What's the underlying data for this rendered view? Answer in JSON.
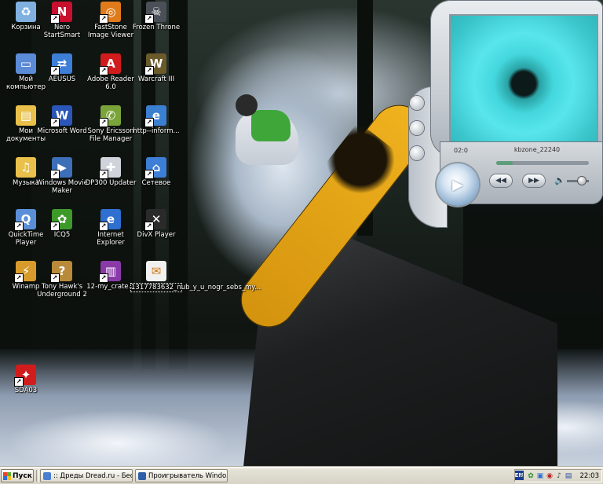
{
  "desktop": {
    "icons": [
      {
        "label": "Корзина",
        "icon": "recycle-bin-icon"
      },
      {
        "label": "Nero StartSmart",
        "icon": "nero-icon"
      },
      {
        "label": "FastStone Image Viewer",
        "icon": "faststone-icon"
      },
      {
        "label": "Frozen Throne",
        "icon": "frozen-throne-icon"
      },
      {
        "label": "Мой компьютер",
        "icon": "my-computer-icon"
      },
      {
        "label": "AEUSUS",
        "icon": "network-icon"
      },
      {
        "label": "Adobe Reader 6.0",
        "icon": "adobe-reader-icon"
      },
      {
        "label": "Warcraft III",
        "icon": "warcraft-icon"
      },
      {
        "label": "Мои документы",
        "icon": "my-documents-icon"
      },
      {
        "label": "Microsoft Word",
        "icon": "word-icon"
      },
      {
        "label": "Sony Ericsson File Manager",
        "icon": "sony-ericsson-icon"
      },
      {
        "label": "http--inform...",
        "icon": "internet-shortcut-icon"
      },
      {
        "label": "Музыка",
        "icon": "music-folder-icon"
      },
      {
        "label": "Windows Movie Maker",
        "icon": "movie-maker-icon"
      },
      {
        "label": "DP300 Updater",
        "icon": "dp300-updater-icon"
      },
      {
        "label": "Сетевое",
        "icon": "network-places-icon"
      },
      {
        "label": "QuickTime Player",
        "icon": "quicktime-icon"
      },
      {
        "label": "ICQ5",
        "icon": "icq-icon"
      },
      {
        "label": "Internet Explorer",
        "icon": "internet-explorer-icon"
      },
      {
        "label": "DivX Player",
        "icon": "divx-player-icon"
      },
      {
        "label": "Winamp",
        "icon": "winamp-icon"
      },
      {
        "label": "Tony Hawk's Underground 2",
        "icon": "tony-hawk-icon"
      },
      {
        "label": "12-my_crate...",
        "icon": "winrar-archive-icon"
      },
      {
        "label": "1317783632_nub_y_u_nogr_sebs_my...",
        "icon": "file-icon"
      },
      {
        "label": "SDA03",
        "icon": "sda-icon"
      }
    ]
  },
  "player": {
    "time": "02:0",
    "title": "kbzone_22240",
    "seek_progress": 0.18,
    "volume_level": 0.6,
    "play_symbol": "▶",
    "prev_symbol": "◀◀",
    "next_symbol": "▶▶",
    "volume_symbol": "🔈"
  },
  "taskbar": {
    "start_label": "Пуск",
    "tasks": [
      {
        "label": ":: Дреды Dread.ru - Бес",
        "icon": "browser-icon"
      },
      {
        "label": "Проигрыватель Windo...",
        "icon": "media-player-icon"
      }
    ],
    "language": "EN",
    "clock": "22:03"
  },
  "colors": {
    "taskbar": "#d7d3c6",
    "player_screen": "#43d7dd",
    "board": "#f0b21e"
  }
}
